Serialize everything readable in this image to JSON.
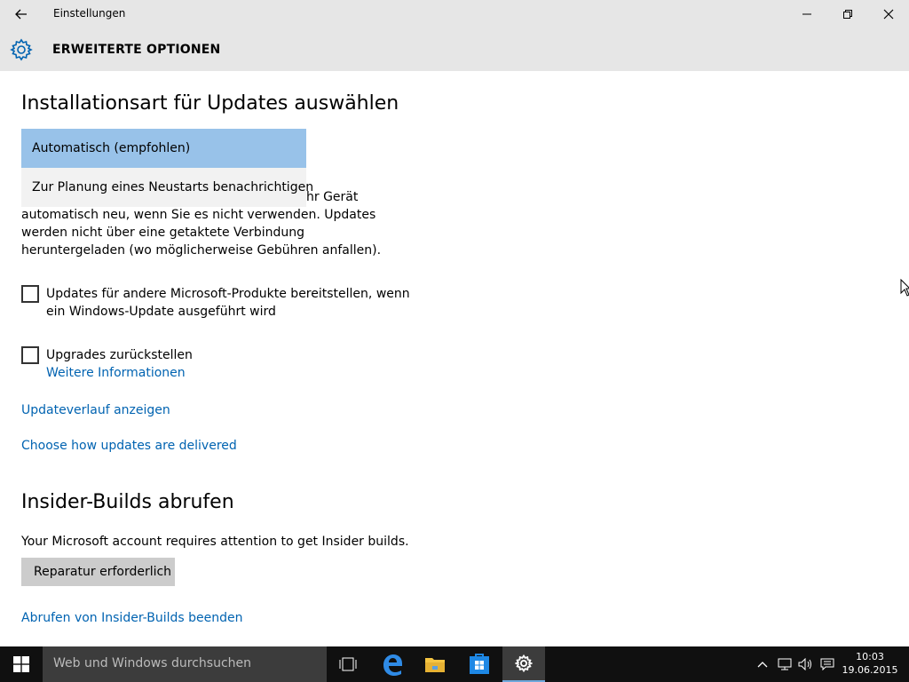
{
  "window": {
    "title": "Einstellungen",
    "header_title": "ERWEITERTE OPTIONEN"
  },
  "updates": {
    "heading": "Installationsart für Updates auswählen",
    "dropdown_options": [
      "Automatisch (empfohlen)",
      "Zur Planung eines Neustarts benachrichtigen"
    ],
    "description_partial": "hr Gerät",
    "description": "automatisch neu, wenn Sie es nicht verwenden. Updates werden nicht über eine getaktete Verbindung heruntergeladen (wo möglicherweise Gebühren anfallen).",
    "checkbox_other_products": "Updates für andere Microsoft-Produkte bereitstellen, wenn ein Windows-Update ausgeführt wird",
    "checkbox_other_products_checked": false,
    "checkbox_defer_upgrades": "Upgrades zurückstellen",
    "checkbox_defer_upgrades_checked": false,
    "more_info_link": "Weitere Informationen",
    "history_link": "Updateverlauf anzeigen",
    "delivery_link": "Choose how updates are delivered"
  },
  "insider": {
    "heading": "Insider-Builds abrufen",
    "message": "Your Microsoft account requires attention to get Insider builds.",
    "repair_button": "Reparatur erforderlich",
    "stop_link": "Abrufen von Insider-Builds beenden"
  },
  "taskbar": {
    "search_placeholder": "Web und Windows durchsuchen",
    "time": "10:03",
    "date": "19.06.2015"
  },
  "colors": {
    "accent": "#0063b1",
    "selected_option": "#98c2e9",
    "titlebar": "#e6e6e6",
    "taskbar": "#101010"
  }
}
